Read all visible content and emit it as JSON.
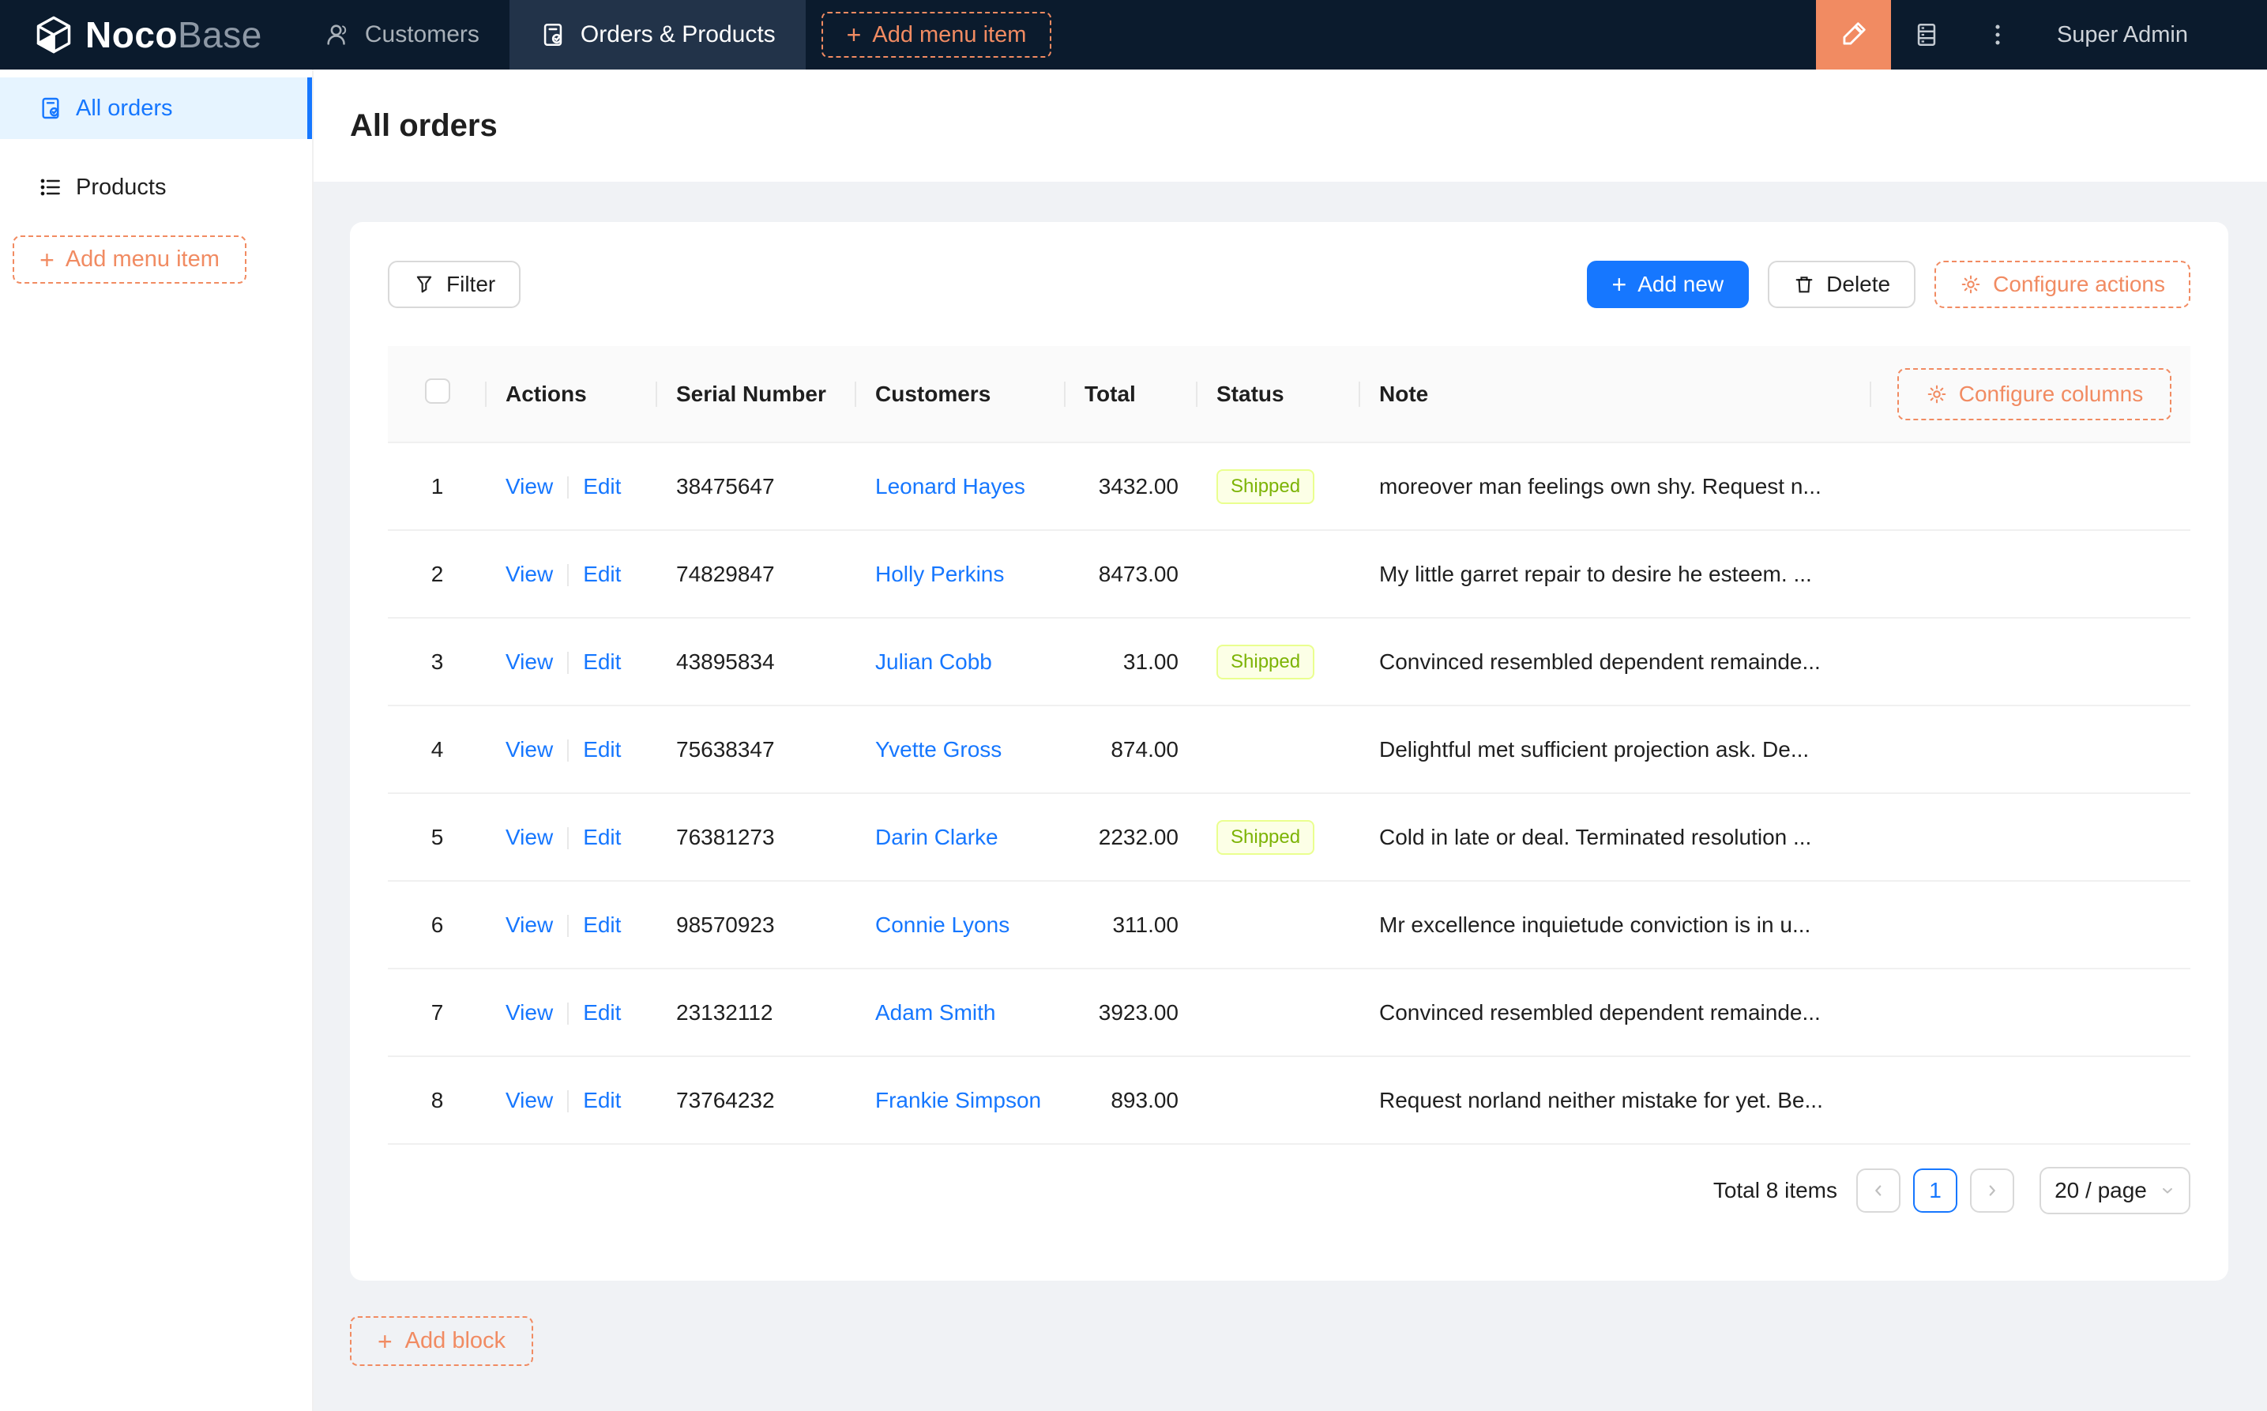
{
  "nav": {
    "brand": {
      "primary": "Noco",
      "secondary": "Base"
    },
    "tabs": [
      {
        "label": "Customers",
        "icon": "user-icon",
        "active": false
      },
      {
        "label": "Orders & Products",
        "icon": "order-check-icon",
        "active": true
      }
    ],
    "add_menu_item_label": "Add menu item",
    "user_name": "Super Admin",
    "icons": [
      "highlighter-icon",
      "server-icon",
      "kebab-menu-icon"
    ]
  },
  "sidebar": {
    "items": [
      {
        "label": "All orders",
        "icon": "file-check-icon",
        "active": true
      },
      {
        "label": "Products",
        "icon": "list-icon",
        "active": false
      }
    ],
    "add_menu_item_label": "Add menu item"
  },
  "page": {
    "title": "All orders"
  },
  "toolbar": {
    "filter_label": "Filter",
    "add_new_label": "Add new",
    "delete_label": "Delete",
    "configure_actions_label": "Configure actions"
  },
  "table": {
    "configure_columns_label": "Configure columns",
    "columns": {
      "actions": "Actions",
      "serial": "Serial Number",
      "customers": "Customers",
      "total": "Total",
      "status": "Status",
      "note": "Note"
    },
    "action_labels": {
      "view": "View",
      "edit": "Edit"
    },
    "rows": [
      {
        "index": "1",
        "serial": "38475647",
        "customer": "Leonard Hayes",
        "total": "3432.00",
        "status": "Shipped",
        "note": "moreover man feelings own shy. Request n..."
      },
      {
        "index": "2",
        "serial": "74829847",
        "customer": "Holly Perkins",
        "total": "8473.00",
        "status": "",
        "note": "My little garret repair to desire he esteem. ..."
      },
      {
        "index": "3",
        "serial": "43895834",
        "customer": "Julian Cobb",
        "total": "31.00",
        "status": "Shipped",
        "note": "Convinced resembled dependent remainde..."
      },
      {
        "index": "4",
        "serial": "75638347",
        "customer": "Yvette Gross",
        "total": "874.00",
        "status": "",
        "note": "Delightful met sufficient projection ask. De..."
      },
      {
        "index": "5",
        "serial": "76381273",
        "customer": "Darin Clarke",
        "total": "2232.00",
        "status": "Shipped",
        "note": "Cold in late or deal. Terminated resolution ..."
      },
      {
        "index": "6",
        "serial": "98570923",
        "customer": "Connie Lyons",
        "total": "311.00",
        "status": "",
        "note": "Mr excellence inquietude conviction is in u..."
      },
      {
        "index": "7",
        "serial": "23132112",
        "customer": "Adam Smith",
        "total": "3923.00",
        "status": "",
        "note": "Convinced resembled dependent remainde..."
      },
      {
        "index": "8",
        "serial": "73764232",
        "customer": "Frankie Simpson",
        "total": "893.00",
        "status": "",
        "note": "Request norland neither mistake for yet. Be..."
      }
    ]
  },
  "pagination": {
    "total_text": "Total 8 items",
    "current_page": "1",
    "page_size": "20 / page"
  },
  "add_block_label": "Add block",
  "colors": {
    "accent_orange": "#F18B62",
    "primary_blue": "#1677FF",
    "nav_bg": "#0B1B2D",
    "nav_tab_active_bg": "#223349",
    "sidebar_active_bg": "#E6F4FF",
    "tag_lime_bg": "#FCFFE6",
    "tag_lime_border": "#EAFF8F",
    "tag_lime_text": "#7CB305",
    "content_bg": "#F0F2F5"
  }
}
